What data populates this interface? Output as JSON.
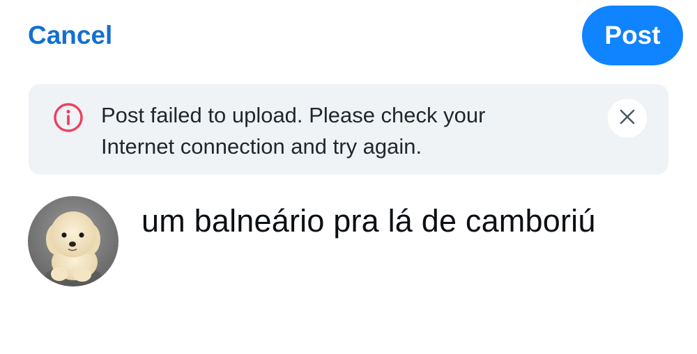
{
  "header": {
    "cancel_label": "Cancel",
    "post_label": "Post"
  },
  "error_banner": {
    "icon": "info-circle-icon",
    "message_line1": "Post failed to upload. Please check your",
    "message_line2": "Internet connection and try again.",
    "close_icon": "close-icon"
  },
  "composer": {
    "avatar": "user-avatar",
    "text": "um balneário pra lá de camboriú"
  },
  "colors": {
    "accent": "#1083fe",
    "link": "#1470cf",
    "error": "#ec4160",
    "banner_bg": "#f0f3f5"
  }
}
